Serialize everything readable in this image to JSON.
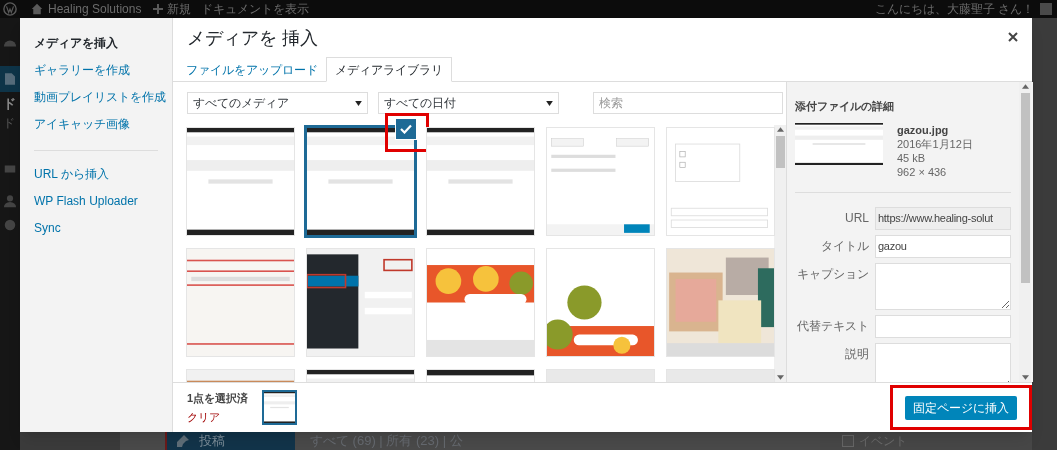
{
  "admin_bar": {
    "site": "Healing Solutions",
    "new": "新規",
    "view": "ドキュメントを表示",
    "greeting": "こんにちは、大藤聖子 さん！"
  },
  "background": {
    "sidebar_labels": [
      "ド",
      "ド"
    ],
    "menu_item": {
      "label": "投稿",
      "selected": true
    },
    "filter_text": "すべて (69) | 所有 (23) | 公",
    "checkbox": {
      "label": "イベント",
      "checked": false
    }
  },
  "modal": {
    "menu_groups": [
      [
        {
          "label": "メディアを挿入",
          "selected": true
        },
        {
          "label": "ギャラリーを作成",
          "selected": false
        },
        {
          "label": "動画プレイリストを作成",
          "selected": false
        },
        {
          "label": "アイキャッチ画像",
          "selected": false
        }
      ],
      [
        {
          "label": "URL から挿入",
          "selected": false
        },
        {
          "label": "WP Flash Uploader",
          "selected": false
        },
        {
          "label": "Sync",
          "selected": false
        }
      ]
    ],
    "title": "メディアを 挿入",
    "tabs": [
      {
        "label": "ファイルをアップロード",
        "selected": false
      },
      {
        "label": "メディアライブラリ",
        "selected": true
      }
    ],
    "filters": [
      {
        "value": "すべてのメディア"
      },
      {
        "value": "すべての日付"
      }
    ],
    "search": {
      "placeholder": "検索"
    },
    "thumbnails": [
      {
        "selected": false
      },
      {
        "selected": true,
        "checked": true,
        "highlighted": true
      },
      {
        "selected": false
      },
      {
        "selected": false
      },
      {
        "selected": false
      },
      {
        "selected": false
      },
      {
        "selected": false
      },
      {
        "selected": false
      },
      {
        "selected": false
      },
      {
        "selected": false
      },
      {
        "selected": false
      },
      {
        "selected": false
      },
      {
        "selected": false
      },
      {
        "selected": false
      },
      {
        "selected": false
      }
    ],
    "details": {
      "heading": "添付ファイルの詳細",
      "filename": "gazou.jpg",
      "date": "2016年1月12日",
      "size": "45 kB",
      "dimensions": "962 × 436",
      "fields": [
        {
          "label": "URL",
          "kind": "input",
          "value": "https://www.healing-solut",
          "readonly": true
        },
        {
          "label": "タイトル",
          "kind": "input",
          "value": "gazou",
          "readonly": false
        },
        {
          "label": "キャプション",
          "kind": "textarea",
          "readonly": false
        },
        {
          "label": "代替テキスト",
          "kind": "input",
          "readonly": false
        },
        {
          "label": "説明",
          "kind": "textarea",
          "readonly": false
        }
      ]
    },
    "footer": {
      "selection_count": "1点を選択済",
      "clear": "クリア",
      "insert_button": {
        "label": "固定ページに挿入",
        "highlighted": true
      }
    }
  }
}
